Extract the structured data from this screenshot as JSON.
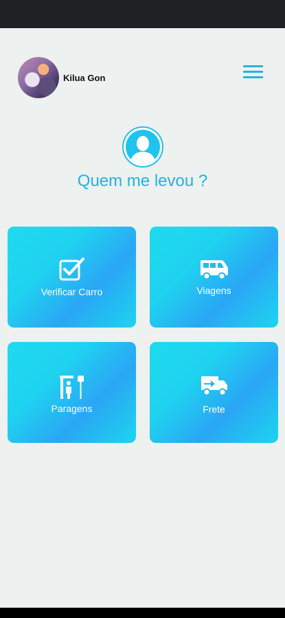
{
  "header": {
    "user_name": "Kilua Gon"
  },
  "profile": {
    "title": "Quem me levou ?"
  },
  "cards": [
    {
      "label": "Verificar Carro",
      "icon": "checkbox-icon"
    },
    {
      "label": "Viagens",
      "icon": "van-icon"
    },
    {
      "label": "Paragens",
      "icon": "bus-stop-icon"
    },
    {
      "label": "Frete",
      "icon": "delivery-truck-icon"
    }
  ],
  "colors": {
    "accent": "#1eb4e3",
    "card_start": "#1fdbee",
    "card_mid": "#2aa6f5",
    "background": "#edf1ef"
  }
}
